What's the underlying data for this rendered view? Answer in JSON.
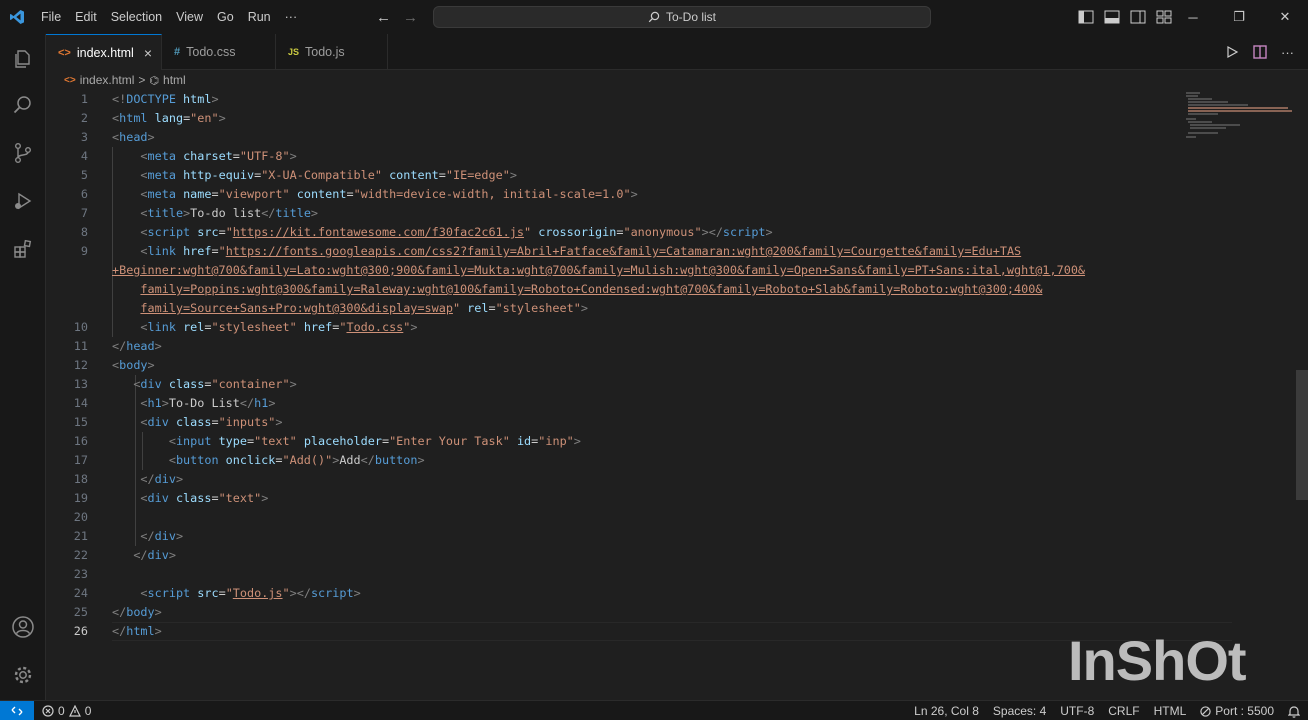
{
  "titlebar": {
    "menu": [
      "File",
      "Edit",
      "Selection",
      "View",
      "Go",
      "Run",
      "···"
    ],
    "search_text": "To-Do list"
  },
  "tabs": [
    {
      "icon": "<>",
      "label": "index.html",
      "active": true,
      "close": "×"
    },
    {
      "icon": "#",
      "label": "Todo.css",
      "active": false
    },
    {
      "icon": "JS",
      "label": "Todo.js",
      "active": false
    }
  ],
  "breadcrumb": {
    "file": "index.html",
    "sep": ">",
    "node": "html"
  },
  "editor": {
    "line_numbers": [
      "1",
      "2",
      "3",
      "4",
      "5",
      "6",
      "7",
      "8",
      "9",
      "",
      "",
      "",
      "10",
      "11",
      "12",
      "13",
      "14",
      "15",
      "16",
      "17",
      "18",
      "19",
      "20",
      "21",
      "22",
      "23",
      "24",
      "25",
      "26"
    ],
    "current_line": "26"
  },
  "status": {
    "errors": "0",
    "warnings": "0",
    "position": "Ln 26, Col 8",
    "spaces": "Spaces: 4",
    "encoding": "UTF-8",
    "eol": "CRLF",
    "language": "HTML",
    "port": "Port : 5500"
  },
  "watermark": "InShOt",
  "colors": {
    "accent": "#0078d4",
    "tag": "#569cd6",
    "attr": "#9cdcfe",
    "string": "#ce9178"
  }
}
